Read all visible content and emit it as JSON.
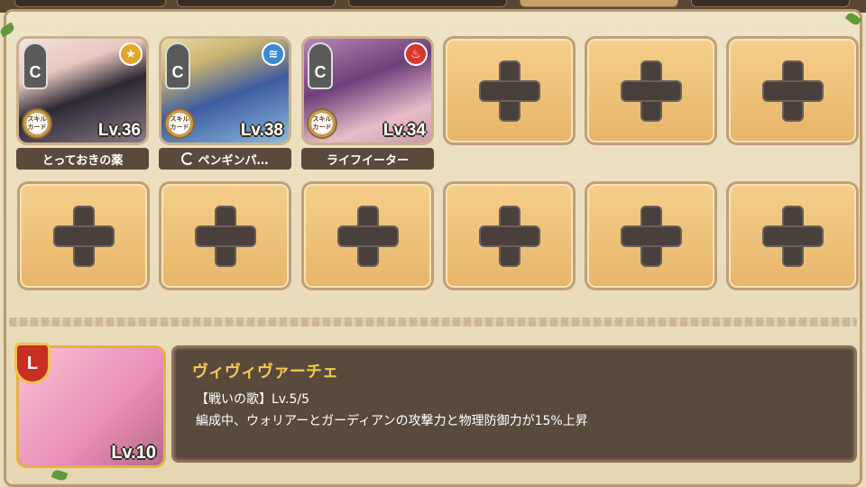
{
  "party": {
    "units": [
      {
        "rank": "C",
        "element_icon": "star-icon",
        "element_color": "#e4a52a",
        "skill_badge": "スキル\nカード",
        "level": "Lv.36",
        "name": "とっておきの薬",
        "art_colors": [
          "#f0d9d0",
          "#2a2530",
          "#6a5a6a"
        ],
        "has_loop_icon": false
      },
      {
        "rank": "C",
        "element_icon": "water-icon",
        "element_color": "#3a8ad8",
        "skill_badge": "スキル\nカード",
        "level": "Lv.38",
        "name": "ペンギンパ…",
        "art_colors": [
          "#e6d79a",
          "#2e4d8a",
          "#6ba9d8"
        ],
        "has_loop_icon": true
      },
      {
        "rank": "C",
        "element_icon": "fire-icon",
        "element_color": "#d8352b",
        "skill_badge": "スキル\nカード",
        "level": "Lv.34",
        "name": "ライフイーター",
        "art_colors": [
          "#a46aa6",
          "#5a2f64",
          "#e7b9c9"
        ],
        "has_loop_icon": false
      }
    ],
    "empty_slot_count": 9
  },
  "leader": {
    "badge": "L",
    "level": "Lv.10",
    "name": "ヴィヴィヴァーチェ",
    "skill_title": "【戦いの歌】Lv.5/5",
    "skill_desc": "編成中、ウォリアーとガーディアンの攻撃力と物理防御力が15%上昇"
  }
}
